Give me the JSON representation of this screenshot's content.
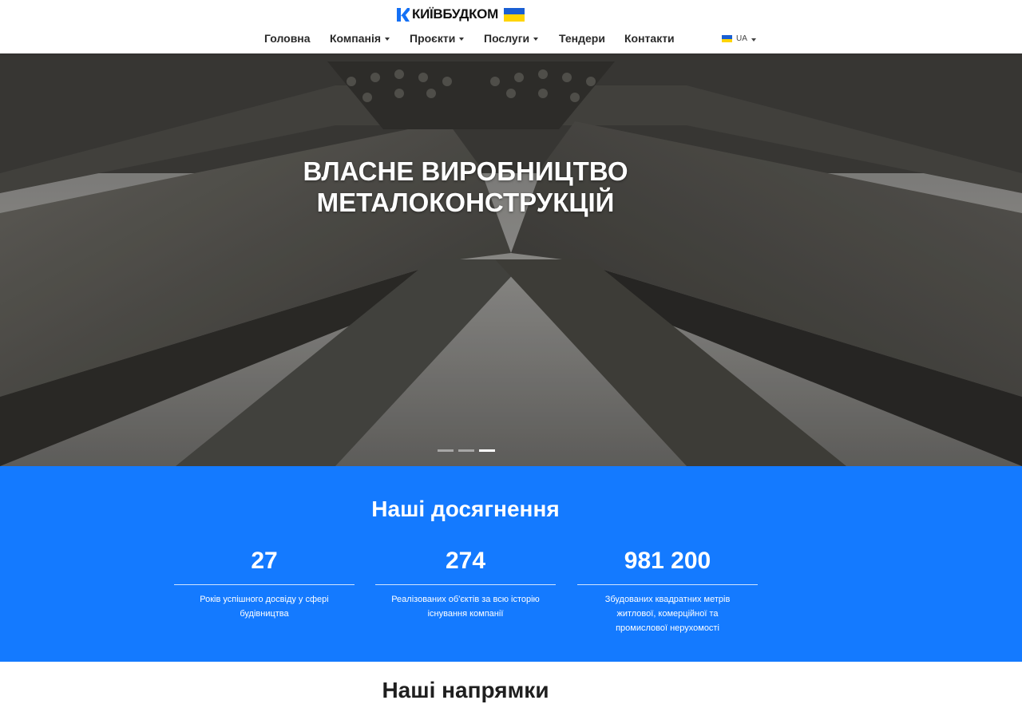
{
  "brand": {
    "name": "КИЇВБУДКОМ",
    "logo_icon": "k-logo-icon",
    "flag_icon": "ukraine-flag-icon"
  },
  "nav": {
    "items": [
      {
        "label": "Головна",
        "has_dropdown": false
      },
      {
        "label": "Компанія",
        "has_dropdown": true
      },
      {
        "label": "Проєкти",
        "has_dropdown": true
      },
      {
        "label": "Послуги",
        "has_dropdown": true
      },
      {
        "label": "Тендери",
        "has_dropdown": false
      },
      {
        "label": "Контакти",
        "has_dropdown": false
      }
    ],
    "language": "UA"
  },
  "hero": {
    "title_line1": "ВЛАСНЕ ВИРОБНИЦТВО",
    "title_line2": "МЕТАЛОКОНСТРУКЦІЙ",
    "slides_total": 3,
    "active_slide": 3
  },
  "achievements": {
    "title": "Наші досягнення",
    "items": [
      {
        "value": "27",
        "text": "Років успішного досвіду у сфері будівництва"
      },
      {
        "value": "274",
        "text": "Реалізованих об'єктів за всю історію існування компанії"
      },
      {
        "value": "981 200",
        "text": "Збудованих квадратних метрів житлової, комерційної та промислової нерухомості"
      }
    ]
  },
  "directions": {
    "title": "Наші напрямки"
  },
  "colors": {
    "accent": "#147aff",
    "text_dark": "#222222",
    "flag_blue": "#1a5fd3",
    "flag_yellow": "#ffd400"
  }
}
